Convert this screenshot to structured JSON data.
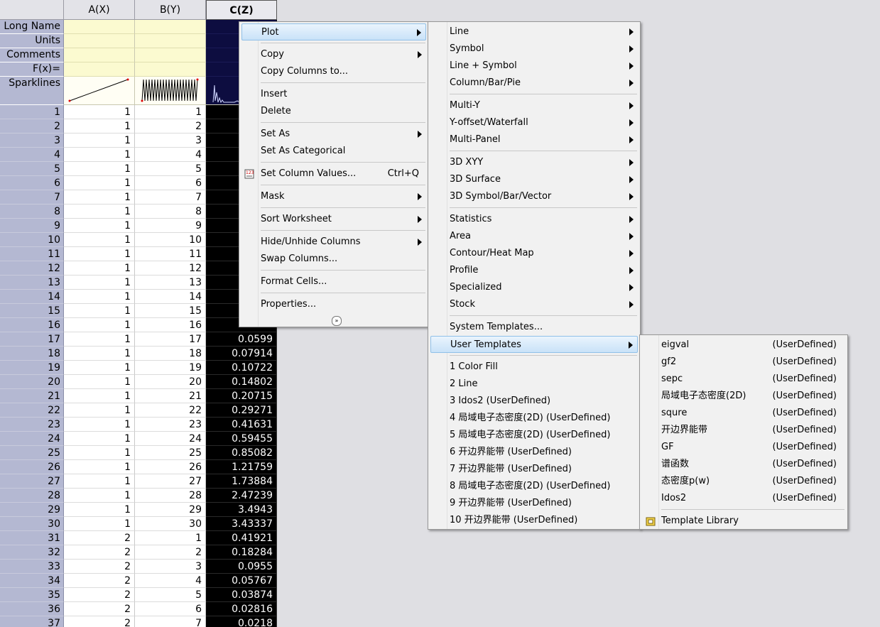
{
  "columns": [
    "A(X)",
    "B(Y)",
    "C(Z)"
  ],
  "row_labels": [
    "Long Name",
    "Units",
    "Comments",
    "F(x)=",
    "Sparklines"
  ],
  "rows": [
    [
      "1",
      "1",
      "1",
      ""
    ],
    [
      "2",
      "1",
      "2",
      ""
    ],
    [
      "3",
      "1",
      "3",
      ""
    ],
    [
      "4",
      "1",
      "4",
      ""
    ],
    [
      "5",
      "1",
      "5",
      ""
    ],
    [
      "6",
      "1",
      "6",
      ""
    ],
    [
      "7",
      "1",
      "7",
      ""
    ],
    [
      "8",
      "1",
      "8",
      ""
    ],
    [
      "9",
      "1",
      "9",
      ""
    ],
    [
      "10",
      "1",
      "10",
      ""
    ],
    [
      "11",
      "1",
      "11",
      ""
    ],
    [
      "12",
      "1",
      "12",
      ""
    ],
    [
      "13",
      "1",
      "13",
      ""
    ],
    [
      "14",
      "1",
      "14",
      ""
    ],
    [
      "15",
      "1",
      "15",
      ""
    ],
    [
      "16",
      "1",
      "16",
      ""
    ],
    [
      "17",
      "1",
      "17",
      "0.0599"
    ],
    [
      "18",
      "1",
      "18",
      "0.07914"
    ],
    [
      "19",
      "1",
      "19",
      "0.10722"
    ],
    [
      "20",
      "1",
      "20",
      "0.14802"
    ],
    [
      "21",
      "1",
      "21",
      "0.20715"
    ],
    [
      "22",
      "1",
      "22",
      "0.29271"
    ],
    [
      "23",
      "1",
      "23",
      "0.41631"
    ],
    [
      "24",
      "1",
      "24",
      "0.59455"
    ],
    [
      "25",
      "1",
      "25",
      "0.85082"
    ],
    [
      "26",
      "1",
      "26",
      "1.21759"
    ],
    [
      "27",
      "1",
      "27",
      "1.73884"
    ],
    [
      "28",
      "1",
      "28",
      "2.47239"
    ],
    [
      "29",
      "1",
      "29",
      "3.4943"
    ],
    [
      "30",
      "1",
      "30",
      "3.43337"
    ],
    [
      "31",
      "2",
      "1",
      "0.41921"
    ],
    [
      "32",
      "2",
      "2",
      "0.18284"
    ],
    [
      "33",
      "2",
      "3",
      "0.0955"
    ],
    [
      "34",
      "2",
      "4",
      "0.05767"
    ],
    [
      "35",
      "2",
      "5",
      "0.03874"
    ],
    [
      "36",
      "2",
      "6",
      "0.02816"
    ],
    [
      "37",
      "2",
      "7",
      "0.0218"
    ]
  ],
  "context_menu": {
    "items": [
      {
        "label": "Plot",
        "submenu": true,
        "highlighted": true
      },
      {
        "sep": true
      },
      {
        "label": "Copy",
        "submenu": true
      },
      {
        "label": "Copy Columns to..."
      },
      {
        "sep": true
      },
      {
        "label": "Insert"
      },
      {
        "label": "Delete"
      },
      {
        "sep": true
      },
      {
        "label": "Set As",
        "submenu": true
      },
      {
        "label": "Set As Categorical"
      },
      {
        "sep": true
      },
      {
        "label": "Set Column Values...",
        "shortcut": "Ctrl+Q",
        "icon": "set-values-icon"
      },
      {
        "sep": true
      },
      {
        "label": "Mask",
        "submenu": true
      },
      {
        "sep": true
      },
      {
        "label": "Sort Worksheet",
        "submenu": true
      },
      {
        "sep": true
      },
      {
        "label": "Hide/Unhide Columns",
        "submenu": true
      },
      {
        "label": "Swap Columns..."
      },
      {
        "sep": true
      },
      {
        "label": "Format Cells..."
      },
      {
        "sep": true
      },
      {
        "label": "Properties..."
      }
    ]
  },
  "plot_menu": {
    "items": [
      {
        "label": "Line",
        "submenu": true
      },
      {
        "label": "Symbol",
        "submenu": true
      },
      {
        "label": "Line + Symbol",
        "submenu": true
      },
      {
        "label": "Column/Bar/Pie",
        "submenu": true
      },
      {
        "sep": true
      },
      {
        "label": "Multi-Y",
        "submenu": true
      },
      {
        "label": "Y-offset/Waterfall",
        "submenu": true
      },
      {
        "label": "Multi-Panel",
        "submenu": true
      },
      {
        "sep": true
      },
      {
        "label": "3D XYY",
        "submenu": true
      },
      {
        "label": "3D Surface",
        "submenu": true
      },
      {
        "label": "3D Symbol/Bar/Vector",
        "submenu": true
      },
      {
        "sep": true
      },
      {
        "label": "Statistics",
        "submenu": true
      },
      {
        "label": "Area",
        "submenu": true
      },
      {
        "label": "Contour/Heat Map",
        "submenu": true
      },
      {
        "label": "Profile",
        "submenu": true
      },
      {
        "label": "Specialized",
        "submenu": true
      },
      {
        "label": "Stock",
        "submenu": true
      },
      {
        "sep": true
      },
      {
        "label": "System Templates..."
      },
      {
        "label": "User Templates",
        "submenu": true,
        "highlighted": true
      },
      {
        "sep": true
      },
      {
        "label": "1 Color Fill"
      },
      {
        "label": "2 Line"
      },
      {
        "label": "3 Idos2 (UserDefined)"
      },
      {
        "label": "4 局域电子态密度(2D) (UserDefined)"
      },
      {
        "label": "5 局域电子态密度(2D) (UserDefined)"
      },
      {
        "label": "6 开边界能带 (UserDefined)"
      },
      {
        "label": "7 开边界能带 (UserDefined)"
      },
      {
        "label": "8 局域电子态密度(2D) (UserDefined)"
      },
      {
        "label": "9 开边界能带 (UserDefined)"
      },
      {
        "label": "10 开边界能带 (UserDefined)"
      }
    ]
  },
  "user_templates_menu": {
    "items": [
      {
        "label": "eigval",
        "tag": "(UserDefined)"
      },
      {
        "label": "gf2",
        "tag": "(UserDefined)"
      },
      {
        "label": "sepc",
        "tag": "(UserDefined)"
      },
      {
        "label": "局域电子态密度(2D)",
        "tag": "(UserDefined)"
      },
      {
        "label": "squre",
        "tag": "(UserDefined)"
      },
      {
        "label": "开边界能带",
        "tag": "(UserDefined)"
      },
      {
        "label": "GF",
        "tag": "(UserDefined)"
      },
      {
        "label": "谱函数",
        "tag": "(UserDefined)"
      },
      {
        "label": "态密度p(w)",
        "tag": "(UserDefined)"
      },
      {
        "label": "Idos2",
        "tag": "(UserDefined)"
      },
      {
        "sep": true
      },
      {
        "label": "Template Library",
        "icon": "template-library-icon"
      }
    ]
  },
  "colors": {
    "highlight": "#c9e2f8",
    "selected_column_bg": "#000000",
    "label_column_bg": "#b4b8d2",
    "meta_rows_bg": "#fbfad0"
  }
}
